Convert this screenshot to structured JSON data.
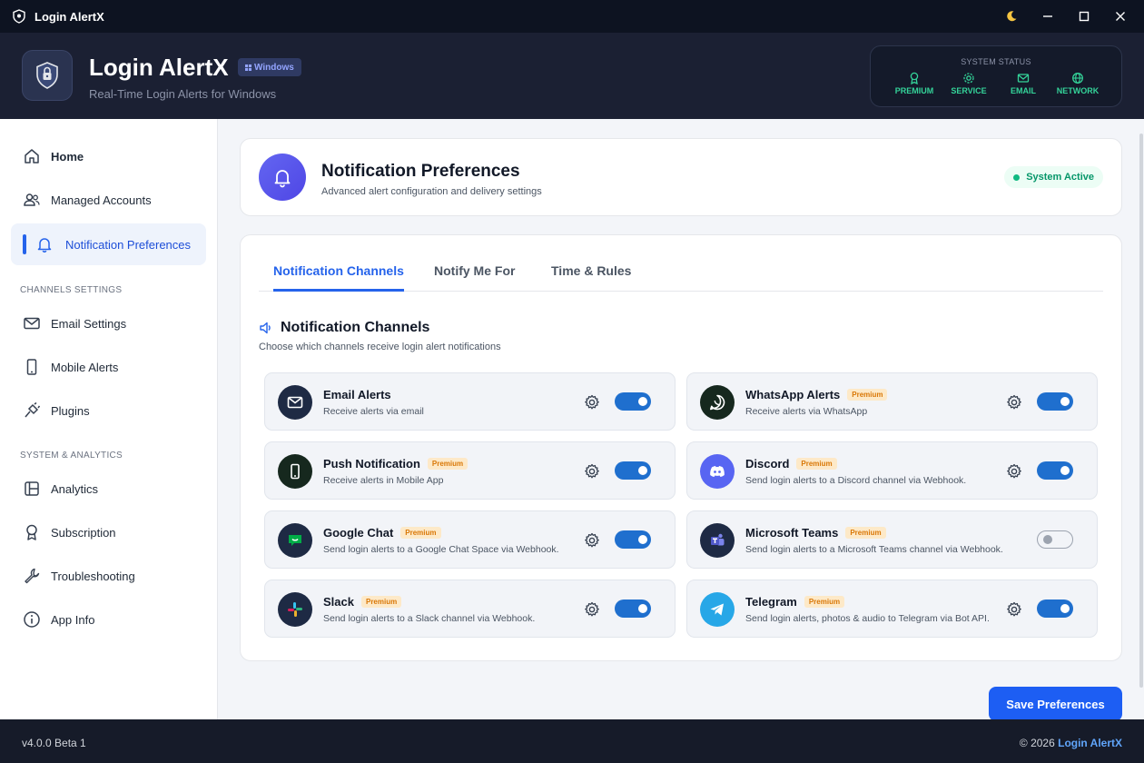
{
  "window": {
    "title": "Login AlertX"
  },
  "header": {
    "app_name": "Login AlertX",
    "platform_badge": "Windows",
    "tagline": "Real-Time Login Alerts for Windows",
    "system_status": {
      "title": "SYSTEM STATUS",
      "items": [
        {
          "label": "PREMIUM",
          "icon": "award-icon"
        },
        {
          "label": "SERVICE",
          "icon": "gear-icon"
        },
        {
          "label": "EMAIL",
          "icon": "mail-icon"
        },
        {
          "label": "NETWORK",
          "icon": "globe-icon"
        }
      ]
    }
  },
  "sidebar": {
    "items": [
      {
        "label": "Home",
        "icon": "home-icon"
      },
      {
        "label": "Managed Accounts",
        "icon": "users-icon"
      },
      {
        "label": "Notification Preferences",
        "icon": "bell-icon",
        "active": true
      }
    ],
    "sections": [
      {
        "title": "CHANNELS SETTINGS",
        "items": [
          {
            "label": "Email Settings",
            "icon": "mail-icon"
          },
          {
            "label": "Mobile Alerts",
            "icon": "phone-icon"
          },
          {
            "label": "Plugins",
            "icon": "plug-icon"
          }
        ]
      },
      {
        "title": "SYSTEM & ANALYTICS",
        "items": [
          {
            "label": "Analytics",
            "icon": "analytics-icon"
          },
          {
            "label": "Subscription",
            "icon": "award-icon"
          },
          {
            "label": "Troubleshooting",
            "icon": "wrench-icon"
          },
          {
            "label": "App Info",
            "icon": "info-icon"
          }
        ]
      }
    ]
  },
  "page": {
    "title": "Notification Preferences",
    "subtitle": "Advanced alert configuration and delivery settings",
    "status": "System Active",
    "tabs": [
      {
        "label": "Notification Channels",
        "active": true
      },
      {
        "label": "Notify Me For"
      },
      {
        "label": "Time & Rules"
      }
    ],
    "section_title": "Notification Channels",
    "section_subtitle": "Choose which channels receive login alert notifications",
    "premium_label": "Premium",
    "channels": [
      {
        "name": "Email Alerts",
        "desc": "Receive alerts via email",
        "premium": false,
        "enabled": true,
        "icon": "mail-icon",
        "color": "#1e2a44"
      },
      {
        "name": "WhatsApp Alerts",
        "desc": "Receive alerts via WhatsApp",
        "premium": true,
        "enabled": true,
        "icon": "whatsapp-icon",
        "color": "#16281e"
      },
      {
        "name": "Push Notification",
        "desc": "Receive alerts in Mobile App",
        "premium": true,
        "enabled": true,
        "icon": "phone-icon",
        "color": "#16281e"
      },
      {
        "name": "Discord",
        "desc": "Send login alerts to a Discord channel via Webhook.",
        "premium": true,
        "enabled": true,
        "icon": "discord-icon",
        "color": "#5865f2"
      },
      {
        "name": "Google Chat",
        "desc": "Send login alerts to a Google Chat Space via Webhook.",
        "premium": true,
        "enabled": true,
        "icon": "google-chat-icon",
        "color": "#1e2a44"
      },
      {
        "name": "Microsoft Teams",
        "desc": "Send login alerts to a Microsoft Teams channel via Webhook.",
        "premium": true,
        "enabled": false,
        "icon": "teams-icon",
        "color": "#1e2a44"
      },
      {
        "name": "Slack",
        "desc": "Send login alerts to a Slack channel via Webhook.",
        "premium": true,
        "enabled": true,
        "icon": "slack-icon",
        "color": "#1e2a44"
      },
      {
        "name": "Telegram",
        "desc": "Send login alerts, photos & audio to Telegram via Bot API.",
        "premium": true,
        "enabled": true,
        "icon": "telegram-icon",
        "color": "#27a7e7"
      }
    ],
    "save_label": "Save Preferences"
  },
  "footer": {
    "version": "v4.0.0 Beta 1",
    "copyright": "© 2026",
    "brand": "Login AlertX"
  },
  "colors": {
    "accent": "#2563eb",
    "toggle_on": "#1f6fce",
    "status_green": "#34d399",
    "premium_text": "#d97706"
  }
}
